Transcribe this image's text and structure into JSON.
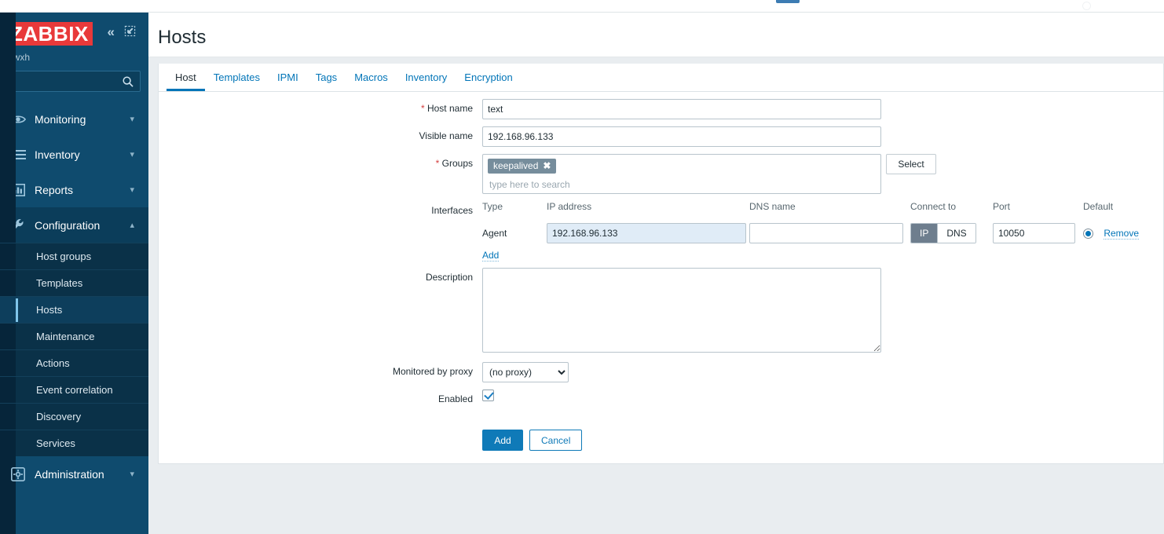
{
  "brand": {
    "logo_text": "ZABBIX",
    "logo_color": "#e8393a",
    "user": "bwxh",
    "collapse_icon": "chevron-double-left-icon",
    "hide_icon": "collapse-panel-icon"
  },
  "search": {
    "value": "",
    "placeholder": "",
    "icon": "search-icon"
  },
  "sidebar": {
    "background": "#0f4b6e",
    "items": [
      {
        "label": "Monitoring",
        "icon": "eye-icon",
        "arrow": "chevron-down-icon",
        "expanded": false
      },
      {
        "label": "Inventory",
        "icon": "list-icon",
        "arrow": "chevron-down-icon",
        "expanded": false
      },
      {
        "label": "Reports",
        "icon": "chart-icon",
        "arrow": "chevron-down-icon",
        "expanded": false
      },
      {
        "label": "Configuration",
        "icon": "wrench-icon",
        "arrow": "chevron-up-icon",
        "expanded": true
      },
      {
        "label": "Administration",
        "icon": "gear-icon",
        "arrow": "chevron-down-icon",
        "expanded": false
      }
    ],
    "configuration_submenu": [
      {
        "label": "Host groups",
        "selected": false
      },
      {
        "label": "Templates",
        "selected": false
      },
      {
        "label": "Hosts",
        "selected": true
      },
      {
        "label": "Maintenance",
        "selected": false
      },
      {
        "label": "Actions",
        "selected": false
      },
      {
        "label": "Event correlation",
        "selected": false
      },
      {
        "label": "Discovery",
        "selected": false
      },
      {
        "label": "Services",
        "selected": false
      }
    ],
    "active_accent": "#7fc5ea"
  },
  "header": {
    "title": "Hosts"
  },
  "tabs": [
    {
      "label": "Host",
      "active": true
    },
    {
      "label": "Templates",
      "active": false
    },
    {
      "label": "IPMI",
      "active": false
    },
    {
      "label": "Tags",
      "active": false
    },
    {
      "label": "Macros",
      "active": false
    },
    {
      "label": "Inventory",
      "active": false
    },
    {
      "label": "Encryption",
      "active": false
    }
  ],
  "form": {
    "host_name": {
      "label": "Host name",
      "required_marker": "*",
      "value": "text",
      "placeholder": ""
    },
    "visible_name": {
      "label": "Visible name",
      "value": "192.168.96.133",
      "placeholder": ""
    },
    "groups": {
      "label": "Groups",
      "required_marker": "*",
      "chips": [
        {
          "label": "keepalived",
          "remove_icon": "close-icon"
        }
      ],
      "placeholder": "type here to search",
      "value": "",
      "select_button": "Select"
    },
    "interfaces": {
      "label": "Interfaces",
      "columns": [
        "Type",
        "IP address",
        "DNS name",
        "Connect to",
        "Port",
        "Default"
      ],
      "rows": [
        {
          "type": "Agent",
          "ip_address": "192.168.96.133",
          "dns_name": "",
          "connect_to": {
            "options": [
              "IP",
              "DNS"
            ],
            "selected": "IP"
          },
          "port": "10050",
          "default_selected": true,
          "remove_label": "Remove"
        }
      ],
      "add_label": "Add"
    },
    "description": {
      "label": "Description",
      "value": "",
      "placeholder": ""
    },
    "monitored_by_proxy": {
      "label": "Monitored by proxy",
      "selected": "(no proxy)",
      "options": [
        "(no proxy)"
      ]
    },
    "enabled": {
      "label": "Enabled",
      "checked": true
    },
    "buttons": {
      "submit": "Add",
      "cancel": "Cancel"
    }
  },
  "colors": {
    "primary": "#0f7ab8",
    "link": "#0275b8",
    "required": "#d43f3f",
    "chip_bg": "#768d9c",
    "segment_on": "#6e7e8e",
    "page_bg": "#e9edf0"
  }
}
